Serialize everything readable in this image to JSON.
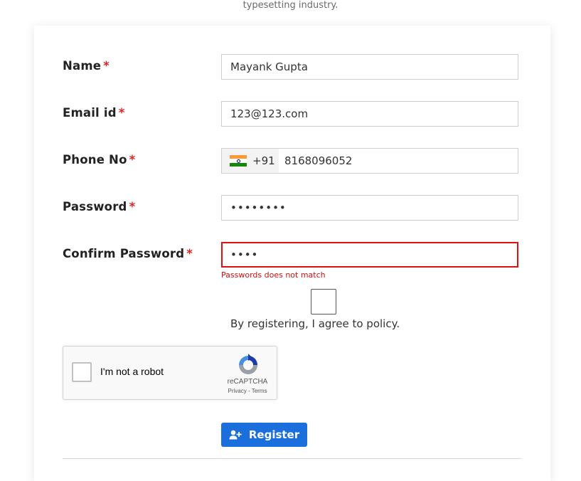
{
  "header": {
    "tagline": "typesetting industry."
  },
  "form": {
    "required_mark": "*",
    "name": {
      "label": "Name",
      "value": "Mayank Gupta"
    },
    "email": {
      "label": "Email id",
      "value": "123@123.com"
    },
    "phone": {
      "label": "Phone No",
      "dial_code": "+91",
      "value": "8168096052",
      "flag_icon": "india-flag-icon"
    },
    "password": {
      "label": "Password",
      "value": "••••••••"
    },
    "confirm_password": {
      "label": "Confirm Password",
      "value": "••••",
      "error": "Passwords does not match"
    },
    "policy_text": "By registering, I agree to policy.",
    "register_label": "Register"
  },
  "recaptcha": {
    "label": "I'm not a robot",
    "brand": "reCAPTCHA",
    "links": "Privacy - Terms"
  },
  "colors": {
    "accent": "#1a6fdc",
    "error": "#e01010",
    "required": "#e02424"
  }
}
